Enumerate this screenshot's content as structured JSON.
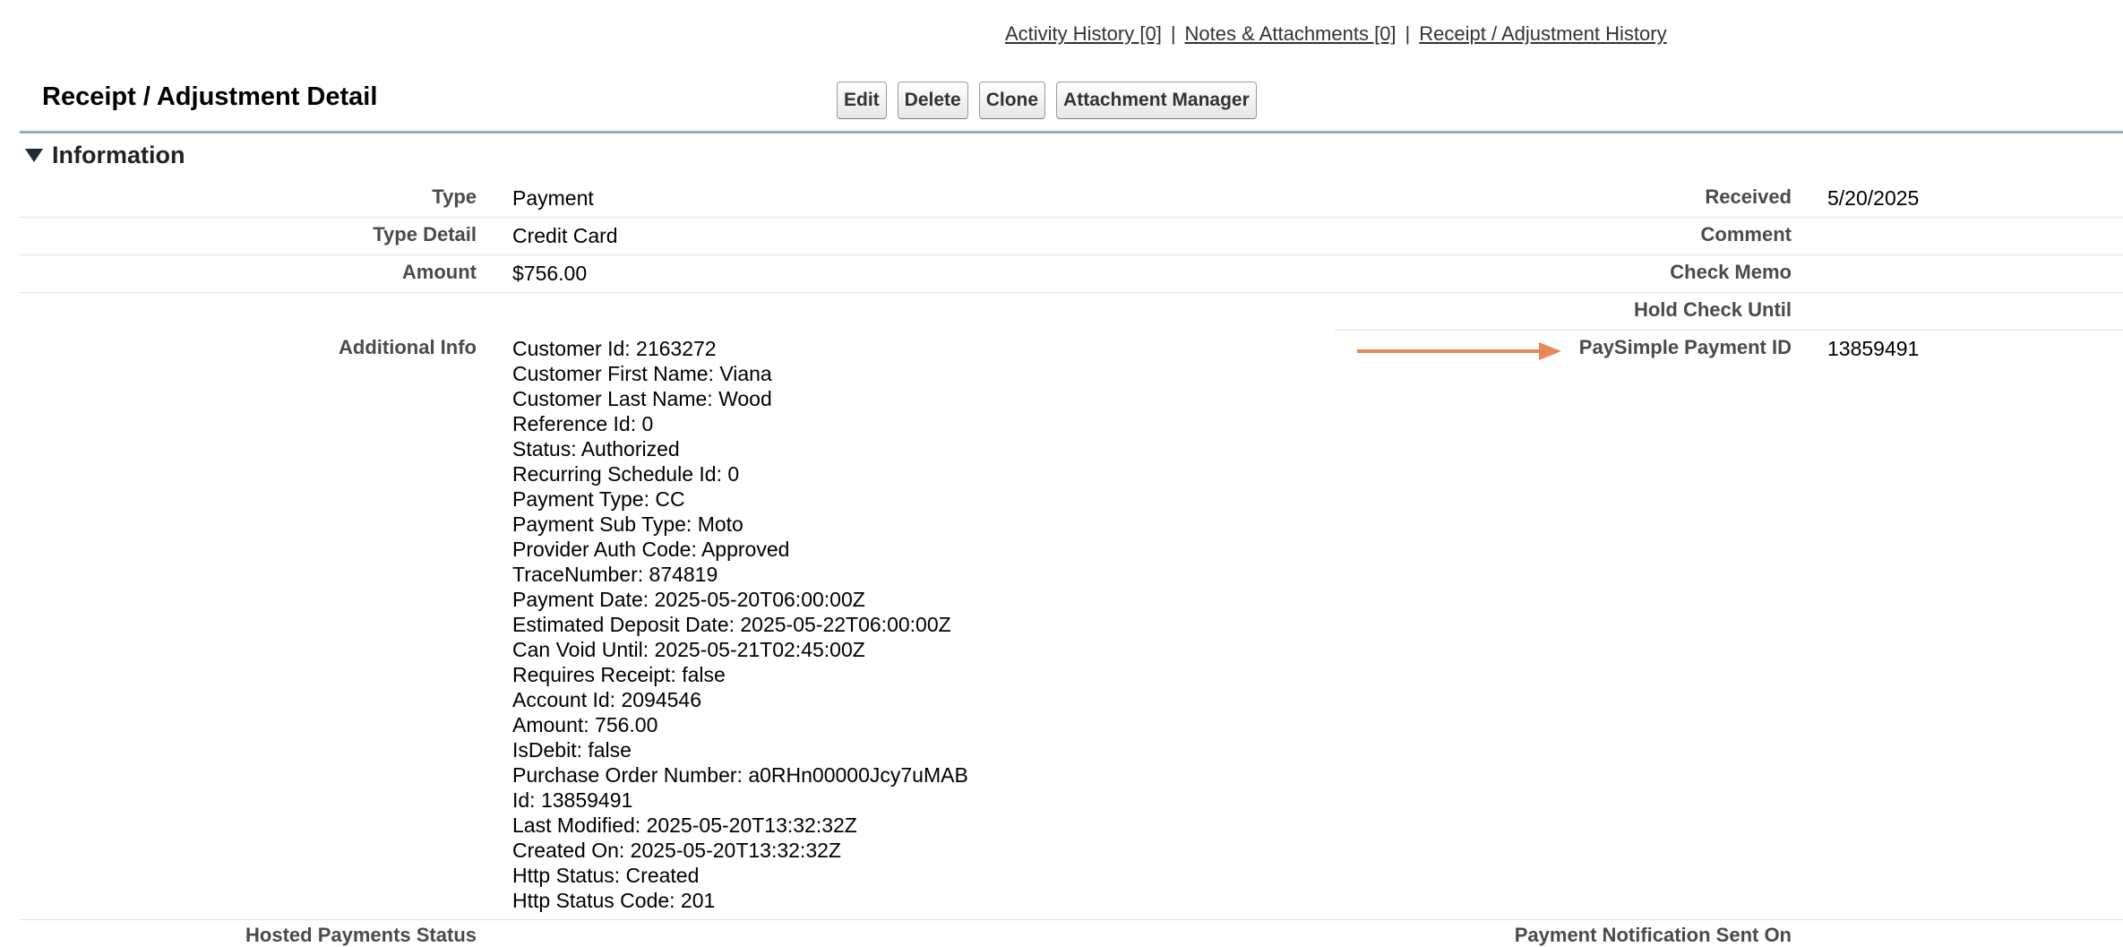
{
  "top_links": {
    "activity_history": "Activity History [0]",
    "notes_attachments": "Notes & Attachments [0]",
    "receipt_adjustment_history": "Receipt / Adjustment History",
    "separator": "|"
  },
  "page": {
    "title": "Receipt / Adjustment Detail"
  },
  "toolbar": {
    "edit": "Edit",
    "delete": "Delete",
    "clone": "Clone",
    "attachment_manager": "Attachment Manager"
  },
  "section": {
    "title": "Information"
  },
  "fields_left": {
    "type_label": "Type",
    "type_value": "Payment",
    "type_detail_label": "Type Detail",
    "type_detail_value": "Credit Card",
    "amount_label": "Amount",
    "amount_value": "$756.00",
    "additional_info_label": "Additional Info"
  },
  "fields_right": {
    "received_label": "Received",
    "received_value": "5/20/2025",
    "comment_label": "Comment",
    "check_memo_label": "Check Memo",
    "hold_check_until_label": "Hold Check Until",
    "paysimple_payment_id_label": "PaySimple Payment ID",
    "paysimple_payment_id_value": "13859491"
  },
  "additional_info": [
    "Customer Id: 2163272",
    "Customer First Name: Viana",
    "Customer Last Name: Wood",
    "Reference Id: 0",
    "Status: Authorized",
    "Recurring Schedule Id: 0",
    "Payment Type: CC",
    "Payment Sub Type: Moto",
    "Provider Auth Code: Approved",
    "TraceNumber: 874819",
    "Payment Date: 2025-05-20T06:00:00Z",
    "Estimated Deposit Date: 2025-05-22T06:00:00Z",
    "Can Void Until: 2025-05-21T02:45:00Z",
    "Requires Receipt: false",
    "Account Id: 2094546",
    "Amount: 756.00",
    "IsDebit: false",
    "Purchase Order Number: a0RHn00000Jcy7uMAB",
    "Id: 13859491",
    "Last Modified: 2025-05-20T13:32:32Z",
    "Created On: 2025-05-20T13:32:32Z",
    "Http Status: Created",
    "Http Status Code: 201"
  ],
  "cut_off_labels": {
    "left": "Hosted Payments Status",
    "right": "Payment Notification Sent On"
  },
  "colors": {
    "arrow": "#e8875a",
    "section_rule": "#8fb1b7"
  },
  "icons": {
    "collapse": "triangle-down-icon",
    "annotation": "arrow-right-icon"
  }
}
